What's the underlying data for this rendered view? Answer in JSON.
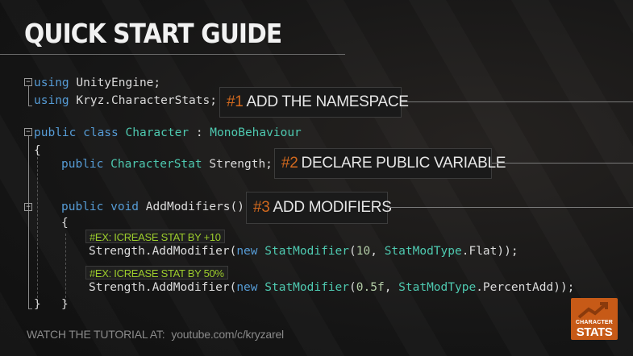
{
  "title": "QUICK START GUIDE",
  "code_lines": {
    "l1": {
      "kw": "using",
      "rest": " UnityEngine;"
    },
    "l2": {
      "kw": "using",
      "rest": " Kryz.CharacterStats;"
    },
    "l3": {
      "kw1": "public",
      "kw2": " class",
      "type": " Character",
      "mid": " : ",
      "base": "MonoBehaviour"
    },
    "l4": "{",
    "l5": {
      "kw": "public",
      "type": " CharacterStat",
      "rest": " Strength;"
    },
    "l6": {
      "kw1": "public",
      "kw2": " void",
      "rest": " AddModifiers()"
    },
    "l7": "{",
    "l8": {
      "pre": "Strength.AddModifier(",
      "kw": "new",
      "type": " StatModifier",
      "p1": "(",
      "num": "10",
      "p2": ", ",
      "enum": "StatModType",
      "p3": ".Flat));"
    },
    "l9": {
      "pre": "Strength.AddModifier(",
      "kw": "new",
      "type": " StatModifier",
      "p1": "(",
      "num": "0.5f",
      "p2": ", ",
      "enum": "StatModType",
      "p3": ".PercentAdd));"
    },
    "l10": "}",
    "l11": "}"
  },
  "callouts": [
    {
      "num": "#1",
      "text": "ADD THE NAMESPACE"
    },
    {
      "num": "#2",
      "text": "DECLARE PUBLIC VARIABLE"
    },
    {
      "num": "#3",
      "text": "ADD MODIFIERS"
    }
  ],
  "examples": [
    {
      "text": "#EX: ICREASE STAT BY +10"
    },
    {
      "text": "#EX: ICREASE STAT BY 50%"
    }
  ],
  "footer": {
    "label": "WATCH THE TUTORIAL AT:",
    "url": "youtube.com/c/kryzarel"
  },
  "logo": {
    "line1": "CHARACTER",
    "line2": "STATS"
  },
  "colors": {
    "keyword": "#569cd6",
    "type": "#4ec9b0",
    "number": "#b5cea8",
    "accent": "#d2691e",
    "example": "#9ccc2c",
    "logo_bg": "#c75a17"
  }
}
